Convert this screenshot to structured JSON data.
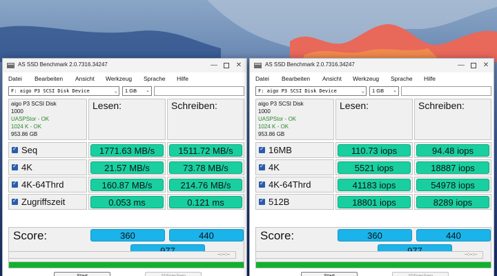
{
  "colors": {
    "value_pill": "#19cfa0",
    "score_pill": "#1ab4ea",
    "progress": "#10b12e",
    "status_ok": "#2a8a2a"
  },
  "windows": [
    {
      "title": "AS SSD Benchmark 2.0.7316.34247",
      "menu": [
        "Datei",
        "Bearbeiten",
        "Ansicht",
        "Werkzeug",
        "Sprache",
        "Hilfe"
      ],
      "drive": "F: aigo P3 SCSI Disk Device",
      "size": "1 GB",
      "info": [
        "aigo P3 SCSI Disk",
        "1000",
        "UASPStor - OK",
        "1024 K - OK",
        "953.86 GB"
      ],
      "headers": {
        "read": "Lesen:",
        "write": "Schreiben:"
      },
      "rows": [
        {
          "label": "Seq",
          "read": "1771.63 MB/s",
          "write": "1511.72 MB/s"
        },
        {
          "label": "4K",
          "read": "21.57 MB/s",
          "write": "73.78 MB/s"
        },
        {
          "label": "4K-64Thrd",
          "read": "160.87 MB/s",
          "write": "214.76 MB/s"
        },
        {
          "label": "Zugriffszeit",
          "read": "0.053 ms",
          "write": "0.121 ms"
        }
      ],
      "score": {
        "label": "Score:",
        "read": "360",
        "write": "440",
        "total": "977"
      },
      "time": "--:--:--",
      "progress": 1.0,
      "buttons": {
        "start": "Start",
        "abort": "Abbrechen"
      }
    },
    {
      "title": "AS SSD Benchmark 2.0.7316.34247",
      "menu": [
        "Datei",
        "Bearbeiten",
        "Ansicht",
        "Werkzeug",
        "Sprache",
        "Hilfe"
      ],
      "drive": "F: aigo P3 SCSI Disk Device",
      "size": "1 GB",
      "info": [
        "aigo P3 SCSI Disk",
        "1000",
        "UASPStor - OK",
        "1024 K - OK",
        "953.86 GB"
      ],
      "headers": {
        "read": "Lesen:",
        "write": "Schreiben:"
      },
      "rows": [
        {
          "label": "16MB",
          "read": "110.73 iops",
          "write": "94.48 iops"
        },
        {
          "label": "4K",
          "read": "5521 iops",
          "write": "18887 iops"
        },
        {
          "label": "4K-64Thrd",
          "read": "41183 iops",
          "write": "54978 iops"
        },
        {
          "label": "512B",
          "read": "18801 iops",
          "write": "8289 iops"
        }
      ],
      "score": {
        "label": "Score:",
        "read": "360",
        "write": "440",
        "total": "977"
      },
      "time": "--:--:--",
      "progress": 1.0,
      "buttons": {
        "start": "Start",
        "abort": "Abbrechen"
      }
    }
  ]
}
